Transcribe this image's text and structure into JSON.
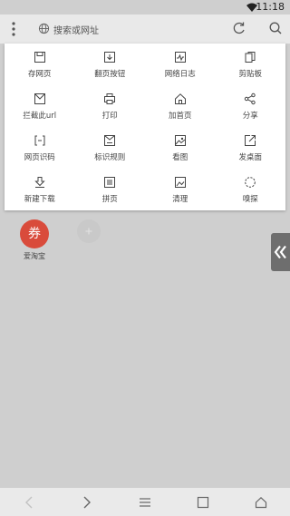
{
  "status_bar": {
    "time": "11:18",
    "wifi_icon": "wifi-icon"
  },
  "top_bar": {
    "search_placeholder": "搜索或网址",
    "icons": [
      "menu-dots-icon",
      "globe-icon",
      "refresh-icon",
      "search-icon"
    ]
  },
  "menu": {
    "items": [
      {
        "label": "存网页",
        "icon": "save-icon"
      },
      {
        "label": "翻页按钮",
        "icon": "page-turn-icon"
      },
      {
        "label": "网络日志",
        "icon": "network-log-icon"
      },
      {
        "label": "剪贴板",
        "icon": "clipboard-icon"
      },
      {
        "label": "拦截此url",
        "icon": "block-url-icon"
      },
      {
        "label": "打印",
        "icon": "print-icon"
      },
      {
        "label": "加首页",
        "icon": "home-add-icon"
      },
      {
        "label": "分享",
        "icon": "share-icon"
      },
      {
        "label": "网页识码",
        "icon": "scan-code-icon"
      },
      {
        "label": "标识规则",
        "icon": "mark-rule-icon"
      },
      {
        "label": "看图",
        "icon": "image-view-icon"
      },
      {
        "label": "发桌面",
        "icon": "send-desktop-icon"
      },
      {
        "label": "新建下载",
        "icon": "download-icon"
      },
      {
        "label": "拼页",
        "icon": "merge-page-icon"
      },
      {
        "label": "清理",
        "icon": "clean-icon"
      },
      {
        "label": "嗅探",
        "icon": "sniff-icon"
      }
    ]
  },
  "shortcuts": {
    "taobao": {
      "icon_text": "券",
      "label": "爱淘宝",
      "color": "#d94b3b"
    }
  },
  "bottom_nav": {
    "icons": [
      "back-icon",
      "forward-icon",
      "menu-icon",
      "tabs-icon",
      "home-icon"
    ]
  },
  "colors": {
    "background": "#cfcfcf",
    "panel": "#ffffff",
    "accent_red": "#d94b3b"
  }
}
